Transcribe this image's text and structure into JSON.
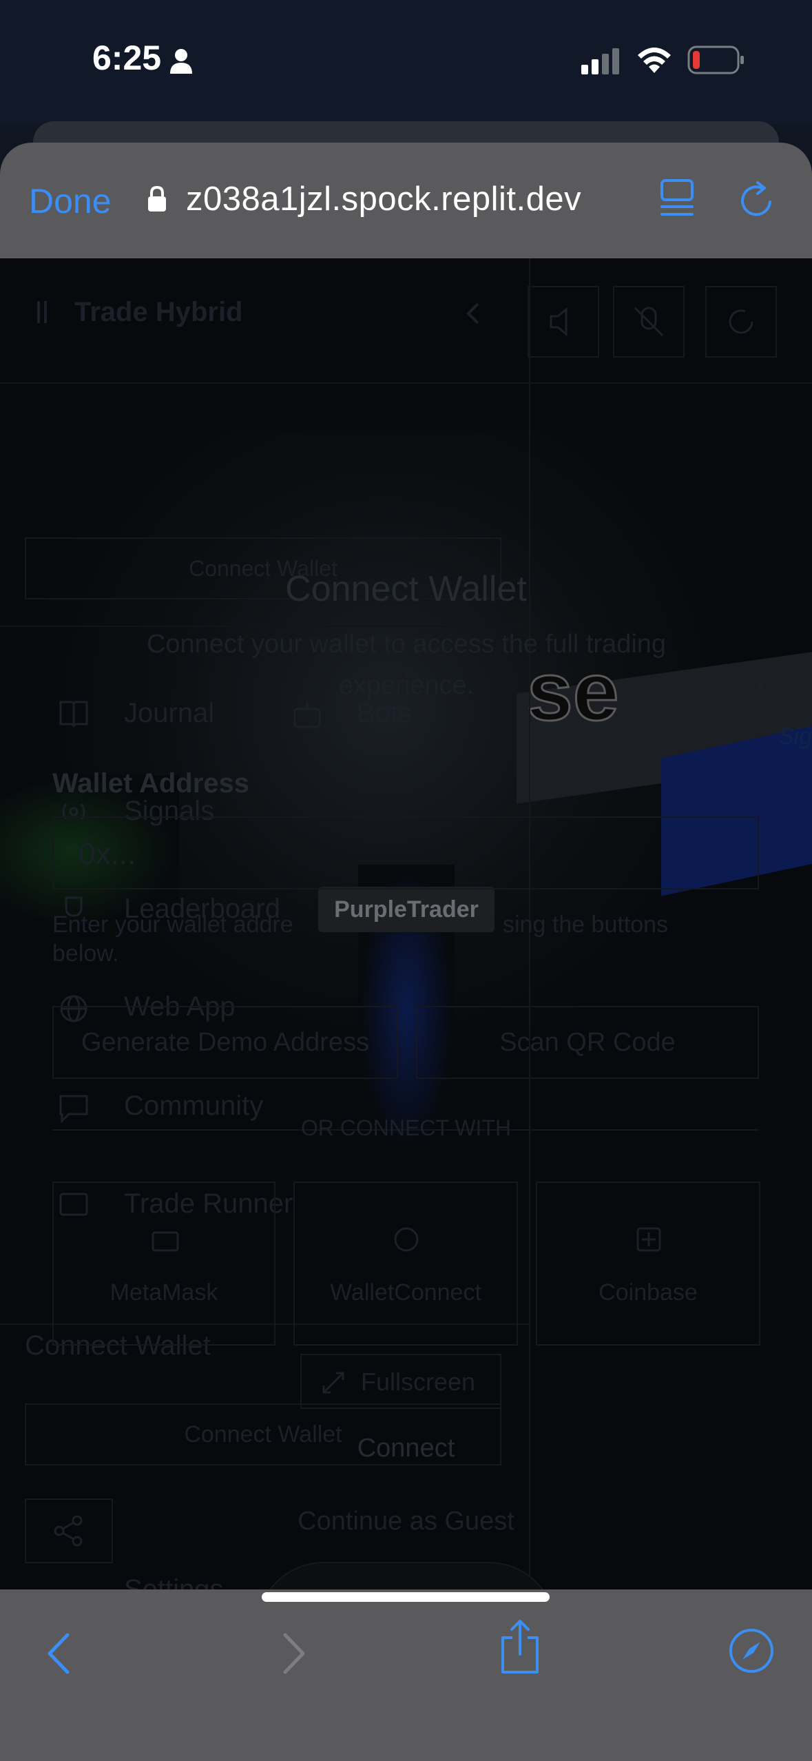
{
  "status_bar": {
    "time": "6:25"
  },
  "browser": {
    "done_label": "Done",
    "url": "z038a1jzl.spock.replit.dev"
  },
  "sidebar": {
    "brand": "Trade Hybrid",
    "connect_wallet_button": "Connect Wallet",
    "items": [
      {
        "label": "Journal",
        "icon": "book-icon"
      },
      {
        "label": "Bots",
        "icon": "bot-icon"
      },
      {
        "label": "Signals",
        "icon": "signal-icon"
      },
      {
        "label": "Leaderboard",
        "icon": "trophy-icon"
      },
      {
        "label": "Web App",
        "icon": "globe-icon"
      },
      {
        "label": "Community",
        "icon": "chat-icon"
      },
      {
        "label": "Trade Runner",
        "icon": "game-icon"
      }
    ],
    "footer_connect_label": "Connect Wallet",
    "footer_connect_button": "Connect Wallet",
    "settings_label": "Settings"
  },
  "modal": {
    "title": "Connect Wallet",
    "description": "Connect your wallet to access the full trading experience.",
    "wallet_address_label": "Wallet Address",
    "wallet_address_placeholder": "0x...",
    "helper_text_left": "Enter your wallet addre",
    "helper_text_right": "sing the buttons",
    "helper_text_line2": "below.",
    "generate_demo_button": "Generate Demo Address",
    "scan_qr_button": "Scan QR Code",
    "divider_label": "OR CONNECT WITH",
    "providers": [
      "MetaMask",
      "WalletConnect",
      "Coinbase"
    ],
    "connect_button": "Connect",
    "guest_button": "Continue as Guest"
  },
  "scene": {
    "sign_text": "se",
    "sig_text": "Sig",
    "player_tag": "PurpleTrader",
    "fullscreen_button": "Fullscreen"
  }
}
